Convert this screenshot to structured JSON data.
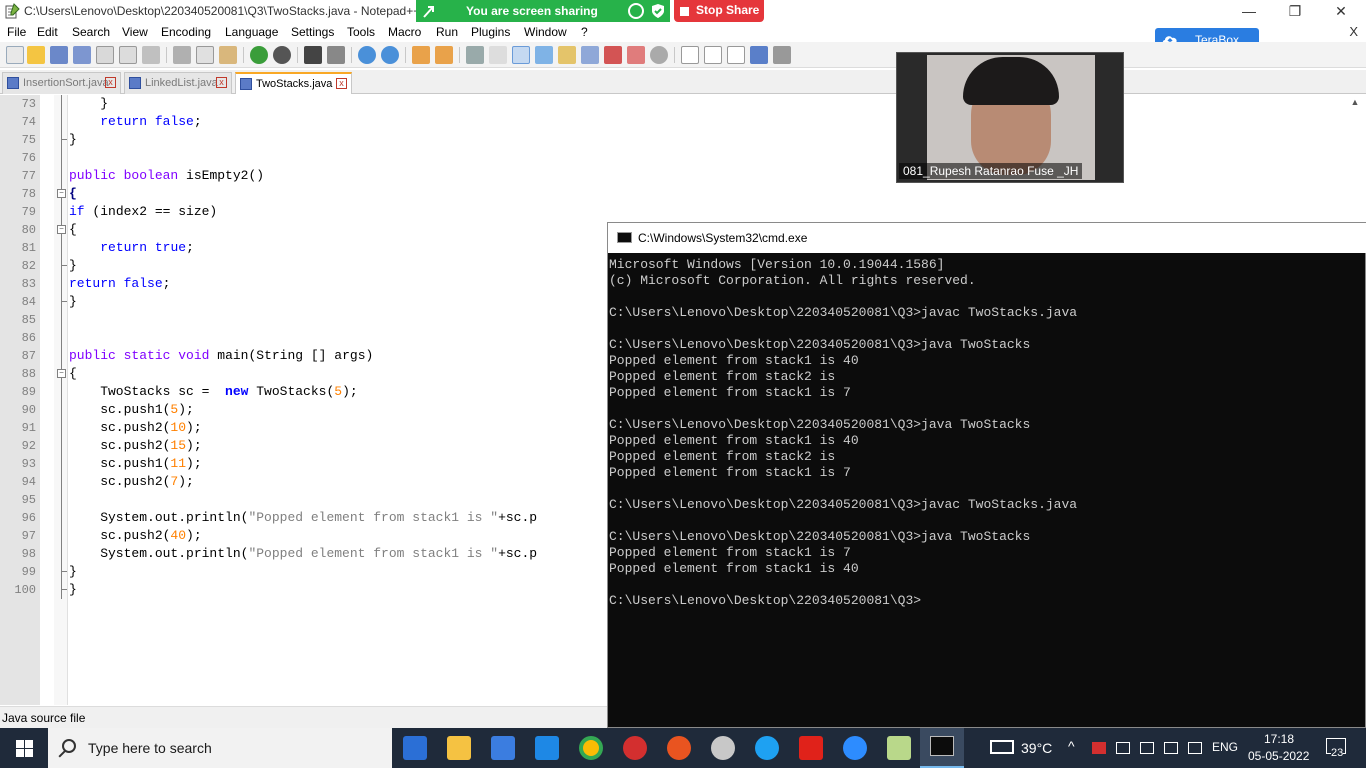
{
  "window": {
    "title": "C:\\Users\\Lenovo\\Desktop\\220340520081\\Q3\\TwoStacks.java - Notepad++",
    "minimize": "—",
    "restore": "❐",
    "close": "✕"
  },
  "screen_share": {
    "status": "You are screen sharing",
    "stop_label": "Stop Share"
  },
  "menu": {
    "items": [
      "File",
      "Edit",
      "Search",
      "View",
      "Encoding",
      "Language",
      "Settings",
      "Tools",
      "Macro",
      "Run",
      "Plugins",
      "Window",
      "?"
    ],
    "close": "X"
  },
  "terabox": {
    "label": "TeraBox"
  },
  "tabs": [
    {
      "label": "InsertionSort.java",
      "active": false
    },
    {
      "label": "LinkedList.java",
      "active": false
    },
    {
      "label": "TwoStacks.java",
      "active": true
    }
  ],
  "editor": {
    "lines": [
      {
        "n": "73",
        "html": "    }"
      },
      {
        "n": "74",
        "html": "    <span class='kw'>return</span> <span class='kw'>false</span>;"
      },
      {
        "n": "75",
        "html": "}"
      },
      {
        "n": "76",
        "html": ""
      },
      {
        "n": "77",
        "html": "<span class='kw2'>public</span> <span class='kw2'>boolean</span> isEmpty2()"
      },
      {
        "n": "78",
        "html": "<span class='op'>{</span>"
      },
      {
        "n": "79",
        "html": "<span class='kw'>if</span> (index2 == size)"
      },
      {
        "n": "80",
        "html": "{"
      },
      {
        "n": "81",
        "html": "    <span class='kw'>return</span> <span class='kw'>true</span>;"
      },
      {
        "n": "82",
        "html": "}"
      },
      {
        "n": "83",
        "html": "<span class='kw'>return</span> <span class='kw'>false</span>;"
      },
      {
        "n": "84",
        "html": "}"
      },
      {
        "n": "85",
        "html": ""
      },
      {
        "n": "86",
        "html": ""
      },
      {
        "n": "87",
        "html": "<span class='kw2'>public</span> <span class='kw2'>static</span> <span class='kw2'>void</span> main(String [] args)"
      },
      {
        "n": "88",
        "html": "{"
      },
      {
        "n": "89",
        "html": "    TwoStacks sc =  <span class='kw'><b>new</b></span> TwoStacks(<span class='num'>5</span>);"
      },
      {
        "n": "90",
        "html": "    sc.push1(<span class='num'>5</span>);"
      },
      {
        "n": "91",
        "html": "    sc.push2(<span class='num'>10</span>);"
      },
      {
        "n": "92",
        "html": "    sc.push2(<span class='num'>15</span>);"
      },
      {
        "n": "93",
        "html": "    sc.push1(<span class='num'>11</span>);"
      },
      {
        "n": "94",
        "html": "    sc.push2(<span class='num'>7</span>);"
      },
      {
        "n": "95",
        "html": ""
      },
      {
        "n": "96",
        "html": "    System.out.println(<span class='str'>\"Popped element from stack1 is \"</span>+sc.p"
      },
      {
        "n": "97",
        "html": "    sc.push2(<span class='num'>40</span>);"
      },
      {
        "n": "98",
        "html": "    System.out.println(<span class='str'>\"Popped element from stack1 is \"</span>+sc.p"
      },
      {
        "n": "99",
        "html": "}"
      },
      {
        "n": "100",
        "html": "}"
      }
    ]
  },
  "status": {
    "file_type": "Java source file"
  },
  "webcam": {
    "name": "081_Rupesh Ratanrao Fuse _JH"
  },
  "cmd": {
    "title": "C:\\Windows\\System32\\cmd.exe",
    "lines": [
      "Microsoft Windows [Version 10.0.19044.1586]",
      "(c) Microsoft Corporation. All rights reserved.",
      "",
      "C:\\Users\\Lenovo\\Desktop\\220340520081\\Q3>javac TwoStacks.java",
      "",
      "C:\\Users\\Lenovo\\Desktop\\220340520081\\Q3>java TwoStacks",
      "Popped element from stack1 is 40",
      "Popped element from stack2 is",
      "Popped element from stack1 is 7",
      "",
      "C:\\Users\\Lenovo\\Desktop\\220340520081\\Q3>java TwoStacks",
      "Popped element from stack1 is 40",
      "Popped element from stack2 is",
      "Popped element from stack1 is 7",
      "",
      "C:\\Users\\Lenovo\\Desktop\\220340520081\\Q3>javac TwoStacks.java",
      "",
      "C:\\Users\\Lenovo\\Desktop\\220340520081\\Q3>java TwoStacks",
      "Popped element from stack1 is 7",
      "Popped element from stack1 is 40",
      "",
      "C:\\Users\\Lenovo\\Desktop\\220340520081\\Q3>"
    ]
  },
  "taskbar": {
    "search_placeholder": "Type here to search",
    "temperature": "39°C",
    "language": "ENG",
    "time": "17:18",
    "date": "05-05-2022",
    "notification_count": "23"
  },
  "colors": {
    "share_green": "#27b24a",
    "stop_red": "#e5363b",
    "terabox_blue": "#2a7de1",
    "cmd_bg": "#0c0c0c",
    "taskbar_bg": "#1f2a3a"
  }
}
